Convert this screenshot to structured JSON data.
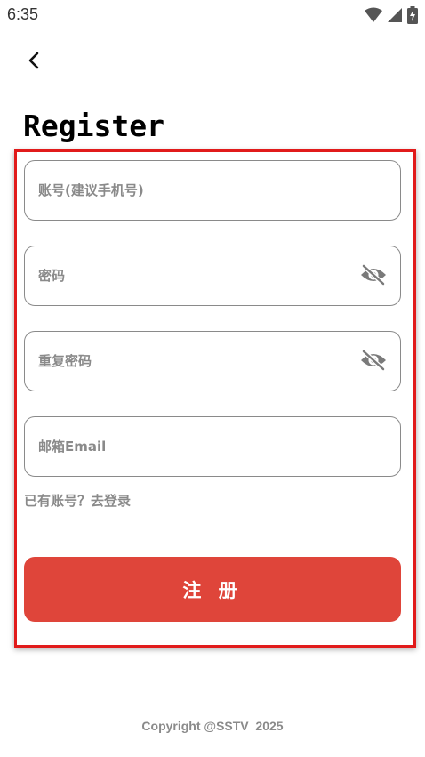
{
  "status_bar": {
    "time": "6:35",
    "icons": [
      "wifi-icon",
      "signal-icon",
      "battery-charging-icon"
    ]
  },
  "header": {
    "back_icon": "chevron-left-icon",
    "title": "Register"
  },
  "form": {
    "account": {
      "placeholder": "账号(建议手机号)",
      "value": ""
    },
    "password": {
      "placeholder": "密码",
      "value": "",
      "toggle_icon": "eye-off-icon"
    },
    "confirm_password": {
      "placeholder": "重复密码",
      "value": "",
      "toggle_icon": "eye-off-icon"
    },
    "email": {
      "placeholder": "邮箱Email",
      "value": ""
    },
    "login_link": "已有账号？去登录",
    "register_label": "注 册"
  },
  "footer": {
    "copyright": "Copyright @SSTV  2025"
  },
  "colors": {
    "primary_button": "#df453a",
    "highlight_border": "#e11b1b",
    "hint_text": "#8a8a8a"
  }
}
